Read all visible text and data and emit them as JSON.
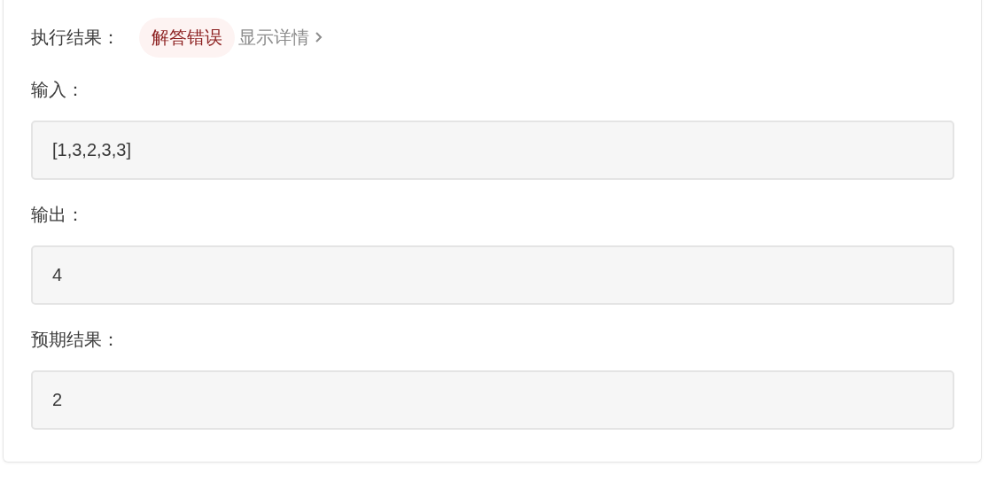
{
  "result": {
    "label": "执行结果：",
    "status": "解答错误",
    "details_link": "显示详情"
  },
  "fields": [
    {
      "label": "输入：",
      "value": "[1,3,2,3,3]"
    },
    {
      "label": "输出：",
      "value": "4"
    },
    {
      "label": "预期结果：",
      "value": "2"
    }
  ]
}
